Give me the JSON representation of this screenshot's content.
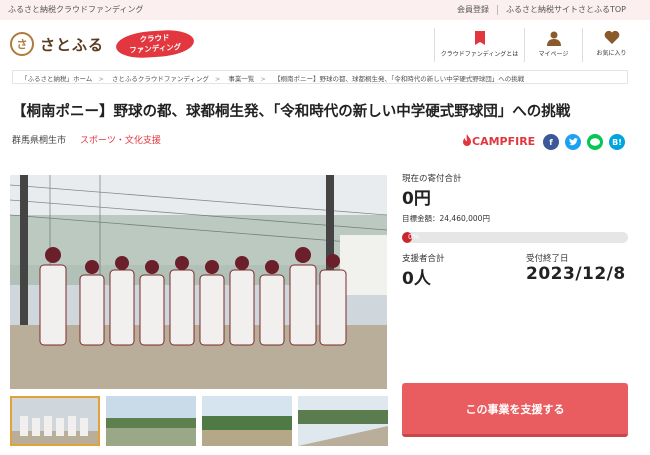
{
  "topbar": {
    "tagline": "ふるさと納税クラウドファンディング",
    "links": [
      "会員登録",
      "ふるさと納税サイトさとふるTOP"
    ]
  },
  "header": {
    "logo_mark": "さ",
    "logo_text": "さとふる",
    "badge_line1": "クラウド",
    "badge_line2": "ファンディング",
    "nav": [
      {
        "label": "クラウドファンディングとは",
        "icon": "book-icon"
      },
      {
        "label": "マイページ",
        "icon": "person-icon"
      },
      {
        "label": "お気に入り",
        "icon": "heart-icon"
      }
    ]
  },
  "breadcrumb": [
    "「ふるさと納税」ホーム",
    "さとふるクラウドファンディング",
    "事業一覧",
    "【桐南ポニー】野球の都、球都桐生発、「令和時代の新しい中学硬式野球団」への挑戦"
  ],
  "project": {
    "title": "【桐南ポニー】野球の都、球都桐生発、「令和時代の新しい中学硬式野球団」への挑戦",
    "prefecture": "群馬県桐生市",
    "category": "スポーツ・文化支援",
    "platform": "CAMPFIRE"
  },
  "share": {
    "hatena": "B!"
  },
  "funding": {
    "current_label": "現在の寄付合計",
    "current_value": "0円",
    "goal_text": "目標金額：24,460,000円",
    "progress_text": "0%",
    "progress_fraction": 0,
    "supporters_label": "支援者合計",
    "supporters_value": "0人",
    "end_label": "受付終了日",
    "end_value": "2023/12/8"
  },
  "cta": {
    "label": "この事業を支援する"
  },
  "colors": {
    "accent": "#e2373f",
    "button": "#e95d60",
    "brand": "#5a3b1e"
  }
}
